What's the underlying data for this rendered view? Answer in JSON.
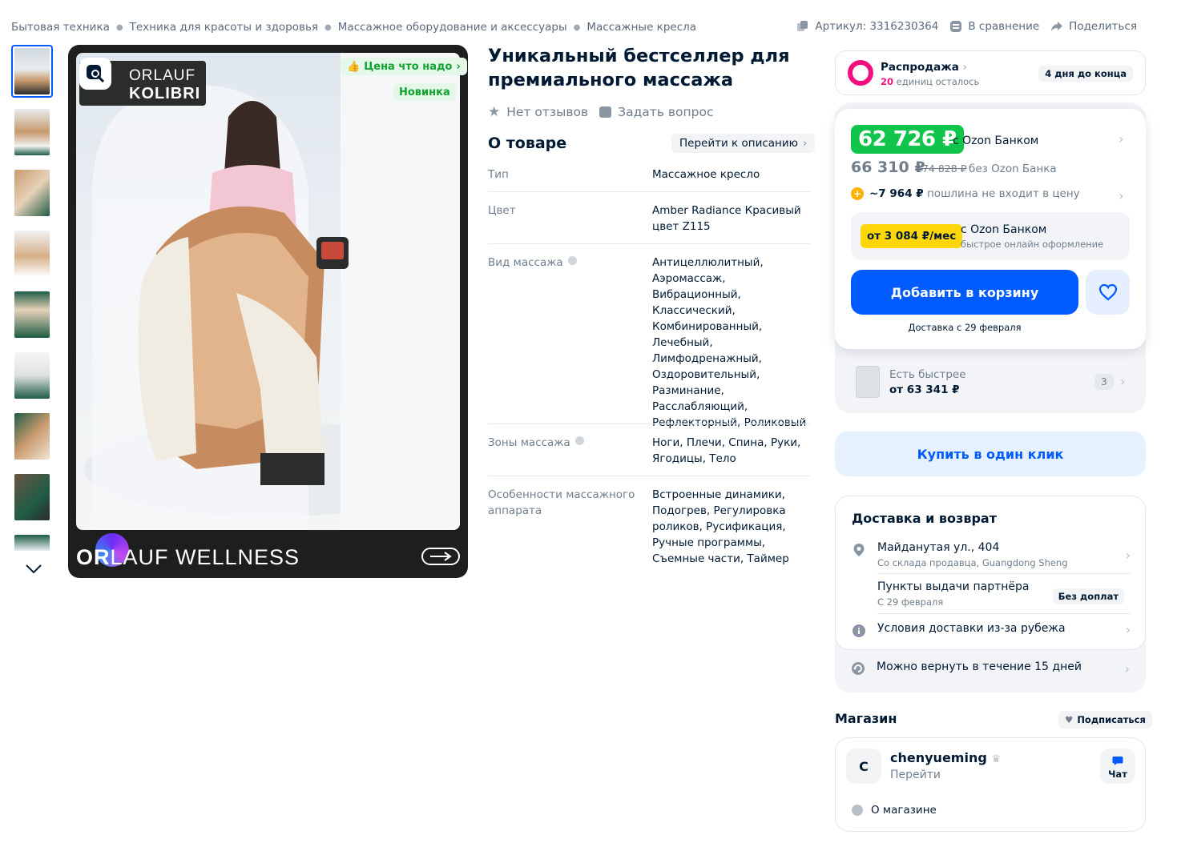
{
  "breadcrumb": [
    "Бытовая техника",
    "Техника для красоты и здоровья",
    "Массажное оборудование и аксессуары",
    "Массажные кресла"
  ],
  "top_actions": {
    "article": "Артикул: 3316230364",
    "compare": "В сравнение",
    "share": "Поделиться"
  },
  "gallery": {
    "brand_line1": "ORLAUF",
    "brand_line2": "KOLIBRI",
    "price_tag": "Цена что надо",
    "new_tag": "Новинка",
    "footer_brand_bold": "OR",
    "footer_brand_rest": "LAUF WELLNESS",
    "thumb_count": 9
  },
  "product": {
    "title": "Уникальный бестселлер для премиального массажа",
    "no_reviews": "Нет отзывов",
    "ask_question": "Задать вопрос",
    "about_heading": "О товаре",
    "goto_description": "Перейти к описанию",
    "specs": [
      {
        "key": "Тип",
        "value": "Массажное кресло"
      },
      {
        "key": "Цвет",
        "value": "Amber Radiance Красивый цвет Z115"
      },
      {
        "key": "Вид массажа",
        "value": "Антицеллюлитный, Аэромассаж, Вибрационный, Классический, Комбинированный, Лечебный, Лимфодренажный, Оздоровительный, Разминание, Расслабляющий, Рефлекторный, Роликовый"
      },
      {
        "key": "Зоны массажа",
        "value": "Ноги, Плечи, Спина, Руки, Ягодицы, Тело"
      },
      {
        "key": "Особенности массажного аппарата",
        "value": "Встроенные динамики, Подогрев, Регулировка роликов, Русификация, Ручные программы, Съемные части, Таймер"
      }
    ]
  },
  "sale": {
    "title": "Распродажа",
    "left_count": "20",
    "left_text": " единиц осталось",
    "days_left": "4 дня до конца"
  },
  "price": {
    "ozon_price": "62 726 ₽",
    "ozon_label": "с Ozon Банком",
    "regular_price": "66 310 ₽",
    "old_price": "174 828 ₽",
    "no_bank_label": "без Ozon Банка",
    "duty_amount": "~7 964 ₽",
    "duty_text": " пошлина не входит в цену",
    "installment_badge": "от 3 084 ₽/мес",
    "installment_title": "с Ozon Банком",
    "installment_sub": "быстрое онлайн оформление",
    "add_to_cart": "Добавить в корзину",
    "delivery_date": "Доставка с 29 февраля",
    "faster_label": "Есть быстрее",
    "faster_price": "от 63 341 ₽",
    "faster_count": "3",
    "buy_one_click": "Купить в один клик"
  },
  "delivery": {
    "heading": "Доставка и возврат",
    "address": "Майданутая ул., 404",
    "address_sub": "Со склада продавца, Guangdong Sheng",
    "pickup": "Пункты выдачи партнёра",
    "pickup_sub": "С 29 февраля",
    "pickup_tag": "Без доплат",
    "abroad": "Условия доставки из-за рубежа",
    "return": "Можно вернуть в течение 15 дней"
  },
  "shop": {
    "heading": "Магазин",
    "subscribe": "Подписаться",
    "avatar_letter": "C",
    "name": "chenyueming",
    "go": "Перейти",
    "chat": "Чат",
    "about": "О магазине"
  },
  "colors": {
    "accent": "#005bff",
    "price_green": "#10c44c",
    "sale_pink": "#f1117e",
    "installment_yellow": "#ffd60a"
  }
}
